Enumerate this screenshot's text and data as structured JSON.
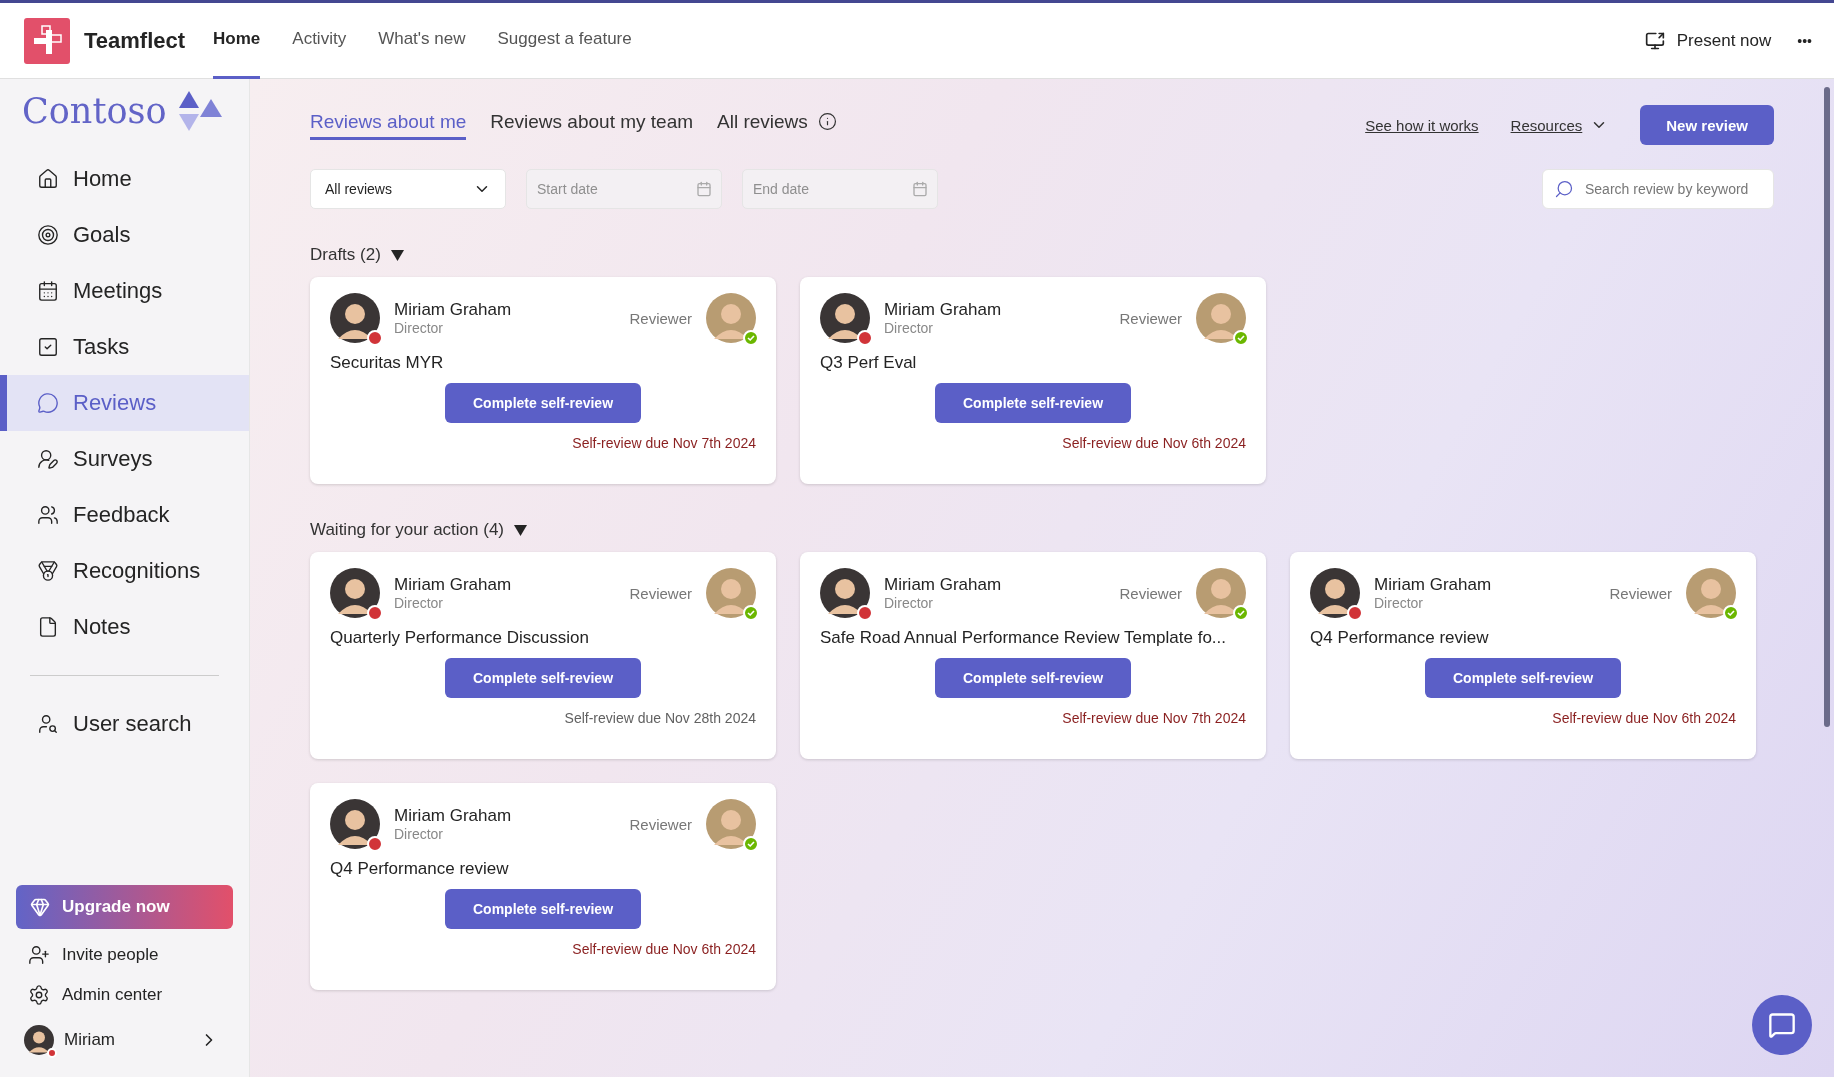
{
  "app_bar": {
    "app_name": "Teamflect",
    "nav": [
      {
        "label": "Home",
        "selected": true
      },
      {
        "label": "Activity",
        "selected": false
      },
      {
        "label": "What's new",
        "selected": false
      },
      {
        "label": "Suggest a feature",
        "selected": false
      }
    ],
    "present_button": "Present now",
    "more_button": "•••"
  },
  "sidebar": {
    "brand": "Contoso",
    "items": [
      {
        "label": "Home",
        "selected": false
      },
      {
        "label": "Goals",
        "selected": false
      },
      {
        "label": "Meetings",
        "selected": false
      },
      {
        "label": "Tasks",
        "selected": false
      },
      {
        "label": "Reviews",
        "selected": true
      },
      {
        "label": "Surveys",
        "selected": false
      },
      {
        "label": "Feedback",
        "selected": false
      },
      {
        "label": "Recognitions",
        "selected": false
      },
      {
        "label": "Notes",
        "selected": false
      }
    ],
    "secondary_items": [
      {
        "label": "User search",
        "selected": false
      }
    ],
    "upgrade_button": "Upgrade now",
    "footer_links": [
      "Invite people",
      "Admin center"
    ],
    "user": {
      "name": "Miriam"
    }
  },
  "review_tabs": [
    {
      "label": "Reviews about me",
      "selected": true,
      "has_info": false
    },
    {
      "label": "Reviews about my team",
      "selected": false,
      "has_info": false
    },
    {
      "label": "All reviews",
      "selected": false,
      "has_info": true
    }
  ],
  "header_links": {
    "how_it_works": "See how it works",
    "resources": "Resources",
    "new_button": "New review"
  },
  "filters": {
    "type_select": "All reviews",
    "start_placeholder": "Start date",
    "end_placeholder": "End date",
    "search_placeholder": "Search review by keyword"
  },
  "sections": [
    {
      "title": "Drafts (2)",
      "expanded": true,
      "cards": [
        {
          "employee_name": "Miriam Graham",
          "employee_role": "Director",
          "reviewer_label": "Reviewer",
          "title": "Securitas MYR",
          "action": "Complete self-review",
          "due": "Self-review due Nov 7th 2024",
          "overdue": true
        },
        {
          "employee_name": "Miriam Graham",
          "employee_role": "Director",
          "reviewer_label": "Reviewer",
          "title": "Q3 Perf Eval",
          "action": "Complete self-review",
          "due": "Self-review due Nov 6th 2024",
          "overdue": true
        }
      ]
    },
    {
      "title": "Waiting for your action (4)",
      "expanded": true,
      "cards": [
        {
          "employee_name": "Miriam Graham",
          "employee_role": "Director",
          "reviewer_label": "Reviewer",
          "title": "Quarterly Performance Discussion",
          "action": "Complete self-review",
          "due": "Self-review due Nov 28th 2024",
          "overdue": false
        },
        {
          "employee_name": "Miriam Graham",
          "employee_role": "Director",
          "reviewer_label": "Reviewer",
          "title": "Safe Road Annual Performance Review Template fo...",
          "action": "Complete self-review",
          "due": "Self-review due Nov 7th 2024",
          "overdue": true
        },
        {
          "employee_name": "Miriam Graham",
          "employee_role": "Director",
          "reviewer_label": "Reviewer",
          "title": "Q4 Performance review",
          "action": "Complete self-review",
          "due": "Self-review due Nov 6th 2024",
          "overdue": true
        },
        {
          "employee_name": "Miriam Graham",
          "employee_role": "Director",
          "reviewer_label": "Reviewer",
          "title": "Q4 Performance review",
          "action": "Complete self-review",
          "due": "Self-review due Nov 6th 2024",
          "overdue": true
        }
      ]
    }
  ]
}
